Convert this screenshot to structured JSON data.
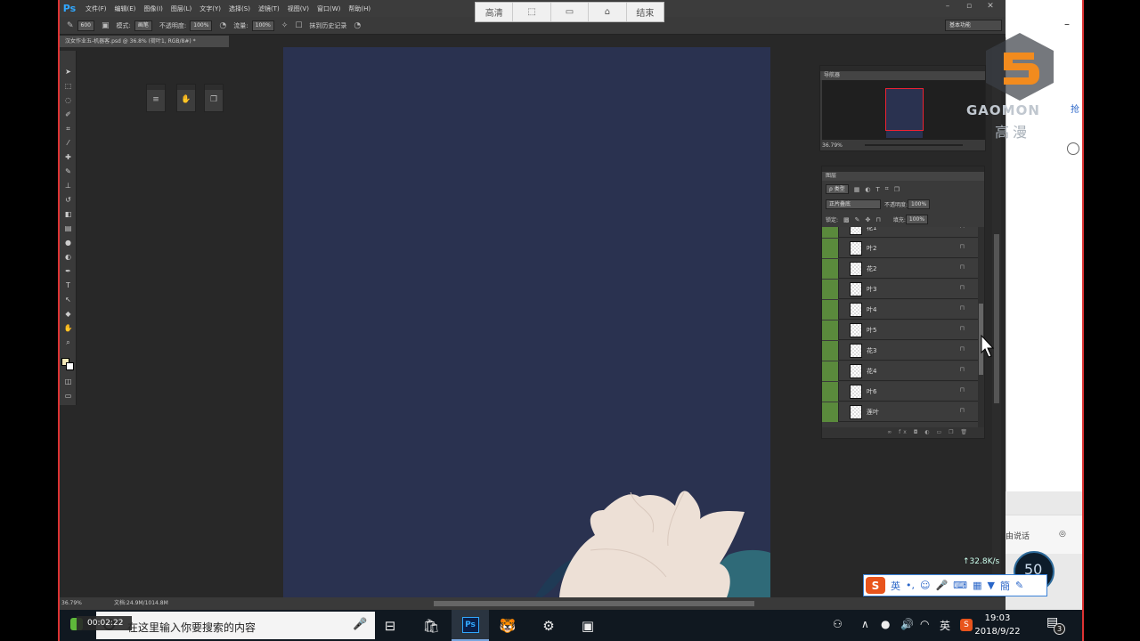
{
  "photoshop": {
    "logo": "Ps",
    "menu": [
      "文件(F)",
      "编辑(E)",
      "图像(I)",
      "图层(L)",
      "文字(Y)",
      "选择(S)",
      "滤镜(T)",
      "视图(V)",
      "窗口(W)",
      "帮助(H)"
    ],
    "options": {
      "brush_size": "600",
      "mode_label": "模式:",
      "mode_value": "画笔",
      "opacity_label": "不透明度:",
      "opacity_value": "100%",
      "flow_label": "流量:",
      "flow_value": "100%",
      "history_label": "抹到历史记录"
    },
    "workspace": "基本功能",
    "doc_tab": "汉女作业五-机器客.psd @ 36.8% (荷叶1, RGB/8#) *",
    "navigator": {
      "title": "导航器",
      "zoom": "36.79%"
    },
    "layers": {
      "title": "图层",
      "filter_kind": "ρ 类型",
      "blend_mode": "正片叠底",
      "opacity_label": "不透明度:",
      "opacity_value": "100%",
      "lock_label": "锁定:",
      "fill_label": "填充:",
      "fill_value": "100%",
      "items": [
        {
          "name": "花1"
        },
        {
          "name": "叶2"
        },
        {
          "name": "花2"
        },
        {
          "name": "叶3"
        },
        {
          "name": "叶4"
        },
        {
          "name": "叶5"
        },
        {
          "name": "花3"
        },
        {
          "name": "花4"
        },
        {
          "name": "叶6"
        },
        {
          "name": "莲叶"
        }
      ]
    },
    "status": {
      "zoom": "36.79%",
      "doc": "文档:24.9M/1014.8M"
    },
    "canvas_color": "#2a3250"
  },
  "capture_toolbar": {
    "hd": "高清",
    "end": "结束"
  },
  "browser": {
    "text1": "由说话",
    "text2": "抢"
  },
  "logo": {
    "word": "GAOMON",
    "cn": "高漫"
  },
  "speed": {
    "net": "↑32.8K/s",
    "num": "50"
  },
  "ime": {
    "lang": "英"
  },
  "taskbar": {
    "search_placeholder": "在这里输入你要搜索的内容",
    "rec_time": "00:02:22",
    "tray_lang": "英",
    "time": "19:03",
    "date": "2018/9/22",
    "notif_count": "3"
  }
}
